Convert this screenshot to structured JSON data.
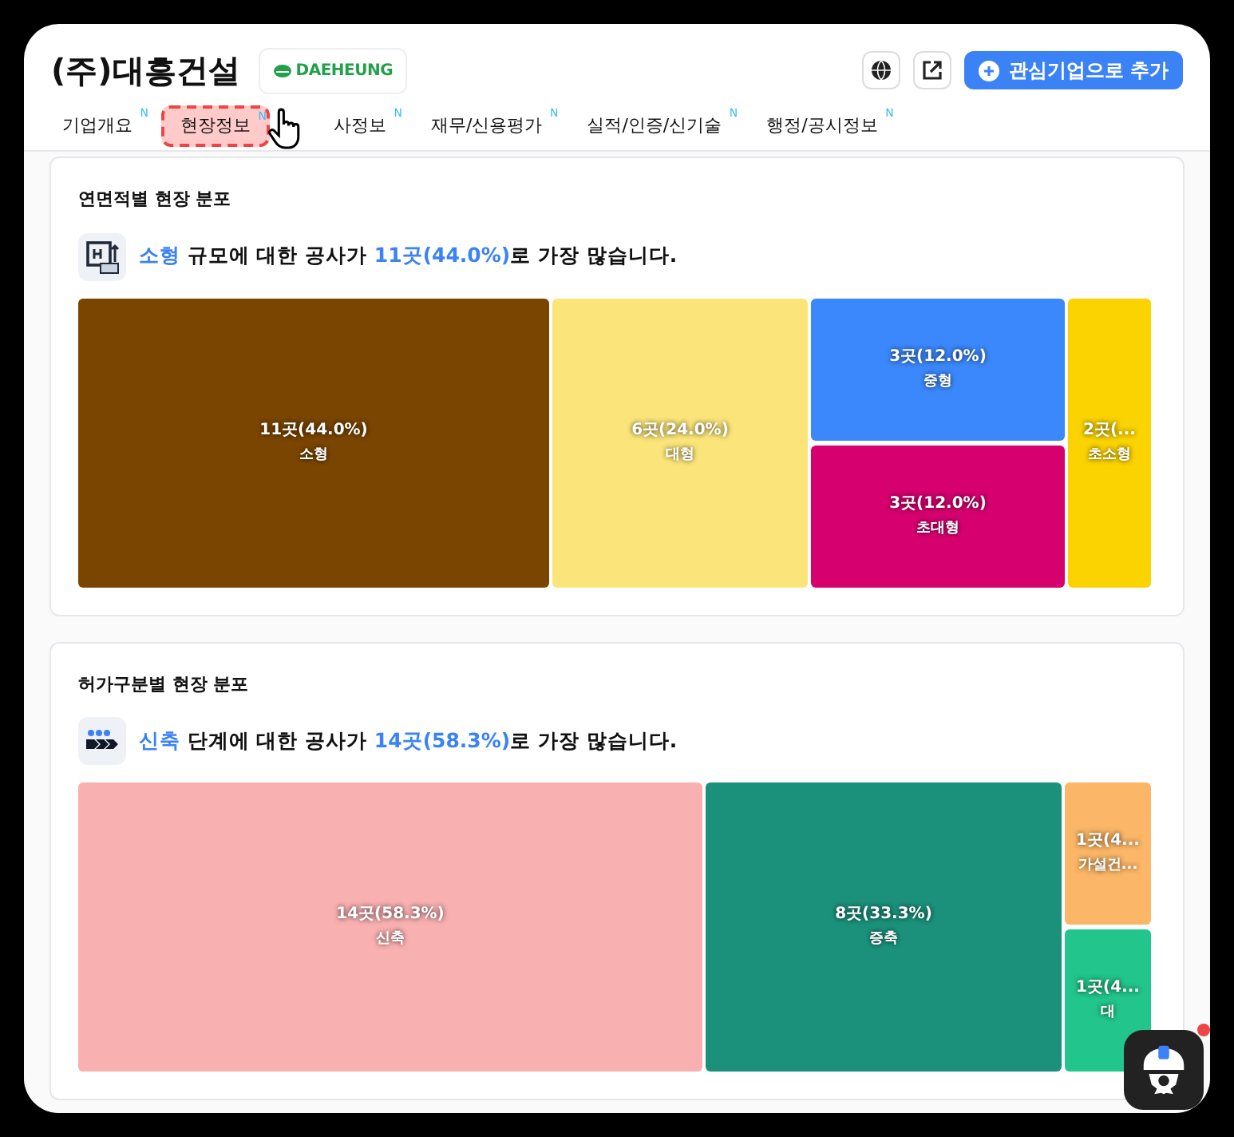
{
  "company": {
    "name": "(주)대흥건설",
    "logo": "DAEHEUNG"
  },
  "actions": {
    "watch_button": "관심기업으로 추가"
  },
  "tabs": [
    {
      "label": "기업개요",
      "badge": "N",
      "selected": false
    },
    {
      "label": "현장정보",
      "badge": "N",
      "selected": true
    },
    {
      "label": "사정보",
      "badge": "N",
      "selected": false
    },
    {
      "label": "재무/신용평가",
      "badge": "N",
      "selected": false
    },
    {
      "label": "실적/인증/신기술",
      "badge": "N",
      "selected": false
    },
    {
      "label": "행정/공시정보",
      "badge": "N",
      "selected": false
    }
  ],
  "sections": [
    {
      "title": "연면적별 현장 분포",
      "kind": "building",
      "summary": {
        "highlight": "소형",
        "middle": " 규모에 대한 공사가 ",
        "count": "11곳(44.0%)",
        "end": "로 가장 많습니다."
      },
      "columns": [
        {
          "tiles": [
            {
              "value": "11곳(44.0%)",
              "name": "소형",
              "color": "#7a4500"
            }
          ]
        },
        {
          "tiles": [
            {
              "value": "6곳(24.0%)",
              "name": "대형",
              "color": "#fbe57a"
            }
          ]
        },
        {
          "tiles": [
            {
              "value": "3곳(12.0%)",
              "name": "중형",
              "color": "#3b88fd"
            },
            {
              "value": "3곳(12.0%)",
              "name": "초대형",
              "color": "#d6006f"
            }
          ]
        },
        {
          "tiles": [
            {
              "value": "2곳(...",
              "name": "초소형",
              "color": "#fad300"
            }
          ]
        }
      ]
    },
    {
      "title": "허가구분별 현장 분포",
      "kind": "arrows",
      "summary": {
        "highlight": "신축",
        "middle": " 단계에 대한 공사가 ",
        "count": "14곳(58.3%)",
        "end": "로 가장 많습니다."
      },
      "columns": [
        {
          "tiles": [
            {
              "value": "14곳(58.3%)",
              "name": "신축",
              "color": "#f9b0b1"
            }
          ]
        },
        {
          "tiles": [
            {
              "value": "8곳(33.3%)",
              "name": "증축",
              "color": "#1b917b"
            }
          ]
        },
        {
          "tiles": [
            {
              "value": "1곳(4...",
              "name": "가설건...",
              "color": "#fbb667"
            },
            {
              "value": "1곳(4...",
              "name": "대",
              "color": "#22c58b"
            }
          ]
        }
      ]
    }
  ]
}
